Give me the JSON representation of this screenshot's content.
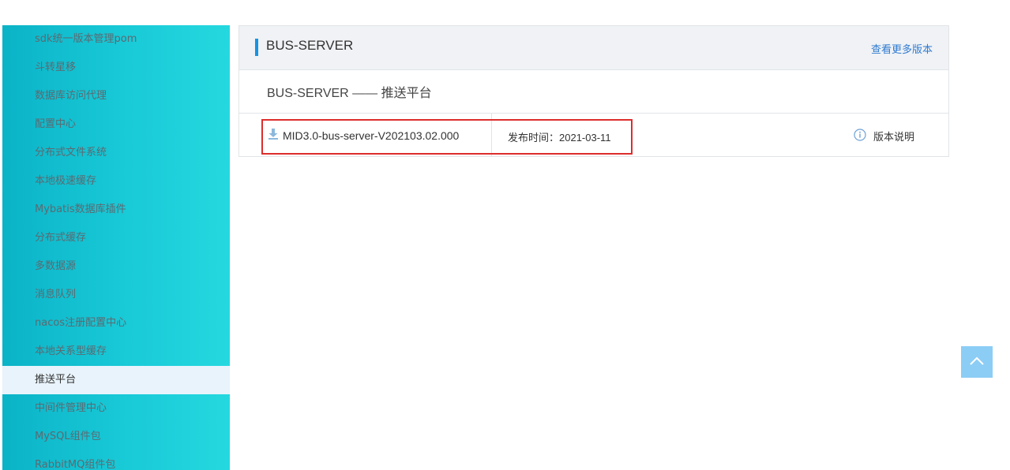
{
  "sidebar": {
    "items": [
      {
        "label": "sdk统一版本管理pom"
      },
      {
        "label": "斗转星移"
      },
      {
        "label": "数据库访问代理"
      },
      {
        "label": "配置中心"
      },
      {
        "label": "分布式文件系统"
      },
      {
        "label": "本地极速缓存"
      },
      {
        "label": "Mybatis数据库插件"
      },
      {
        "label": "分布式缓存"
      },
      {
        "label": "多数据源"
      },
      {
        "label": "消息队列"
      },
      {
        "label": "nacos注册配置中心"
      },
      {
        "label": "本地关系型缓存"
      },
      {
        "label": "推送平台",
        "active": true
      },
      {
        "label": "中间件管理中心"
      },
      {
        "label": "MySQL组件包"
      },
      {
        "label": "RabbitMQ组件包"
      }
    ]
  },
  "panel": {
    "title": "BUS-SERVER",
    "more_link": "查看更多版本",
    "subtitle": "BUS-SERVER —— 推送平台",
    "release": {
      "file_name": "MID3.0-bus-server-V202103.02.000",
      "date_label": "发布时间：",
      "date_value": "2021-03-11",
      "notes_label": "版本说明"
    }
  },
  "colors": {
    "accent": "#1694e4",
    "sidebar_gradient_start": "#0bb3c7",
    "sidebar_gradient_end": "#25d8df",
    "highlight_box": "#dd2d2d",
    "link": "#2f7bd1",
    "back_to_top": "#8ccdf5"
  },
  "icons": {
    "download": "download-icon",
    "info": "info-icon",
    "back_to_top": "chevron-up-icon"
  }
}
